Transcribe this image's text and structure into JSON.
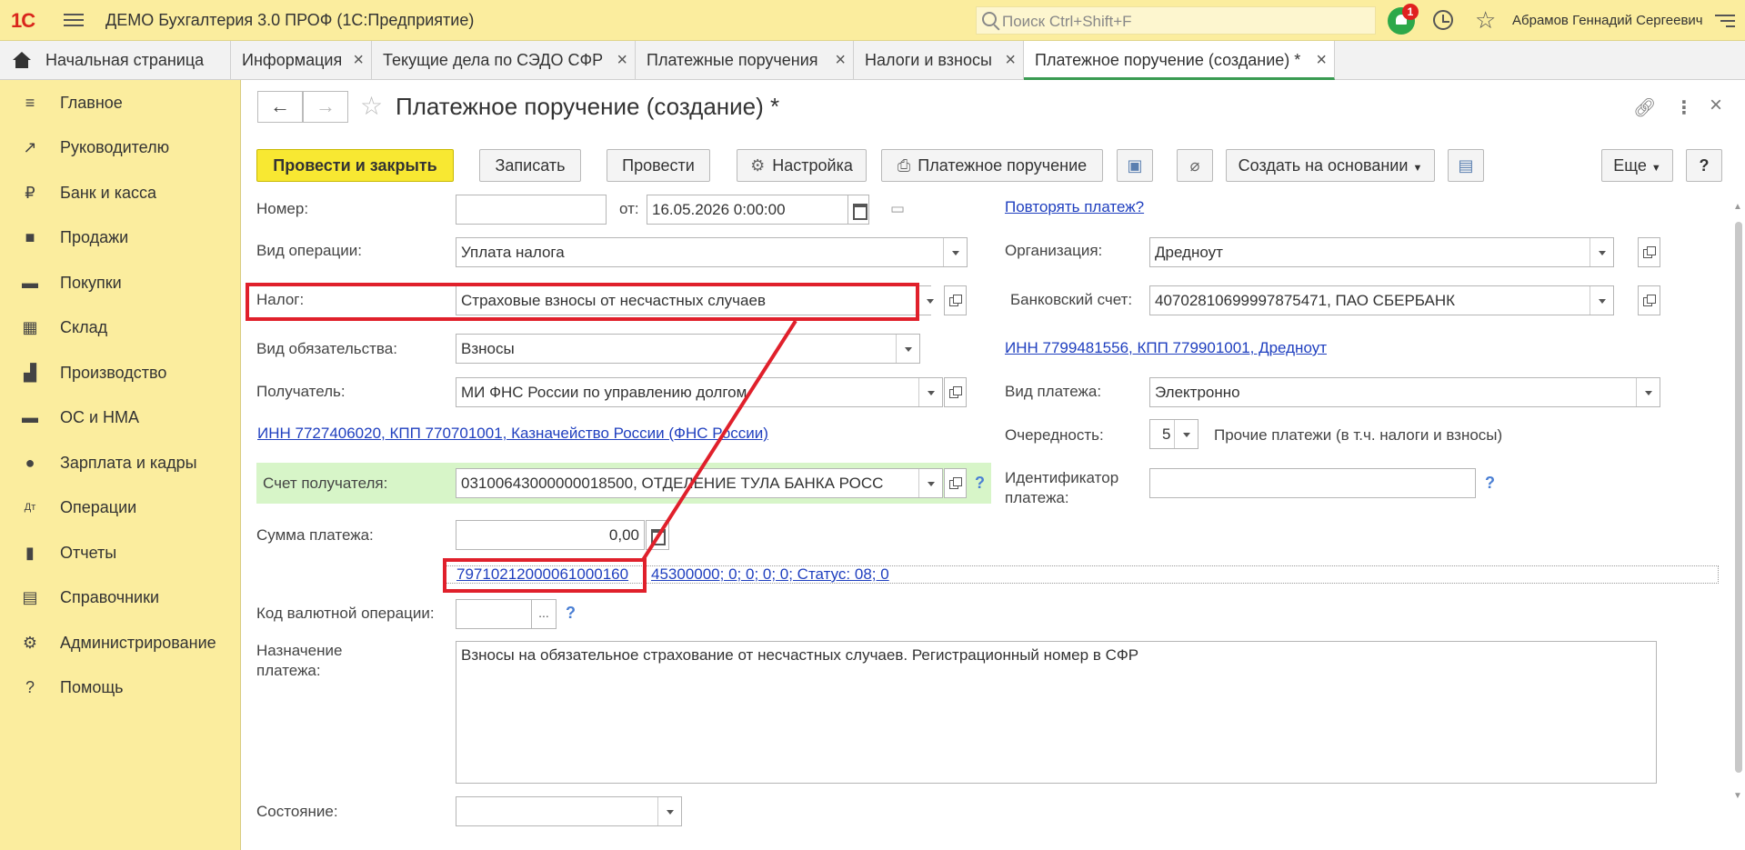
{
  "app": {
    "logo": "1С",
    "title": "ДЕМО Бухгалтерия 3.0 ПРОФ  (1С:Предприятие)",
    "search_placeholder": "Поиск Ctrl+Shift+F",
    "notifications_count": "1",
    "user": "Абрамов Геннадий Сергеевич"
  },
  "tabs": [
    {
      "label": "Начальная страница"
    },
    {
      "label": "Информация"
    },
    {
      "label": "Текущие дела по СЭДО СФР"
    },
    {
      "label": "Платежные поручения"
    },
    {
      "label": "Налоги и взносы"
    },
    {
      "label": "Платежное поручение (создание) *"
    }
  ],
  "sidebar": {
    "items": [
      {
        "label": "Главное",
        "icon": "menu-icon"
      },
      {
        "label": "Руководителю",
        "icon": "trend-icon"
      },
      {
        "label": "Банк и касса",
        "icon": "ruble-icon"
      },
      {
        "label": "Продажи",
        "icon": "bag-icon"
      },
      {
        "label": "Покупки",
        "icon": "cart-icon"
      },
      {
        "label": "Склад",
        "icon": "warehouse-icon"
      },
      {
        "label": "Производство",
        "icon": "factory-icon"
      },
      {
        "label": "ОС и НМА",
        "icon": "truck-icon"
      },
      {
        "label": "Зарплата и кадры",
        "icon": "person-icon"
      },
      {
        "label": "Операции",
        "icon": "dt-kt-icon"
      },
      {
        "label": "Отчеты",
        "icon": "bar-chart-icon"
      },
      {
        "label": "Справочники",
        "icon": "books-icon"
      },
      {
        "label": "Администрирование",
        "icon": "gear-icon"
      },
      {
        "label": "Помощь",
        "icon": "question-icon"
      }
    ]
  },
  "form": {
    "title": "Платежное поручение (создание) *",
    "toolbar": {
      "post_close": "Провести и закрыть",
      "save": "Записать",
      "post": "Провести",
      "settings": "Настройка",
      "print": "Платежное поручение",
      "create_based": "Создать на основании",
      "more": "Еще",
      "help": "?"
    },
    "number_label": "Номер:",
    "number_value": "",
    "date_label": "от:",
    "date_value": "16.05.2026  0:00:00",
    "repeat_link": "Повторять платеж?",
    "operation_label": "Вид операции:",
    "operation_value": "Уплата налога",
    "org_label": "Организация:",
    "org_value": "Дредноут",
    "tax_label": "Налог:",
    "tax_value": "Страховые взносы от несчастных случаев",
    "bank_label": "Банковский счет:",
    "bank_value": "40702810699997875471, ПАО СБЕРБАНК",
    "obligation_label": "Вид обязательства:",
    "obligation_value": "Взносы",
    "org_inn_link": "ИНН 7799481556, КПП 779901001, Дредноут",
    "recipient_label": "Получатель:",
    "recipient_value": "МИ ФНС России по управлению долгом",
    "payment_type_label": "Вид платежа:",
    "payment_type_value": "Электронно",
    "recipient_inn_link": "ИНН 7727406020, КПП 770701001, Казначейство России (ФНС России)",
    "priority_label": "Очередность:",
    "priority_value": "5",
    "priority_desc": "Прочие платежи (в т.ч. налоги и взносы)",
    "account_label": "Счет получателя:",
    "account_value": "03100643000000018500, ОТДЕЛЕНИЕ ТУЛА БАНКА РОСС",
    "identifier_label_1": "Идентификатор",
    "identifier_label_2": "платежа:",
    "identifier_value": "",
    "amount_label": "Сумма платежа:",
    "amount_value": "0,00",
    "kbk_link": "79710212000061000160",
    "kbk_rest": "45300000; 0; 0; 0; 0; Статус: 08; 0",
    "currency_label": "Код валютной операции:",
    "currency_value": "",
    "purpose_label_1": "Назначение",
    "purpose_label_2": "платежа:",
    "purpose_value": "Взносы на обязательное страхование от несчастных случаев. Регистрационный номер в СФР",
    "state_label": "Состояние:",
    "state_value": ""
  },
  "colors": {
    "accent_yellow": "#fbed9e",
    "primary_button": "#f8e832",
    "highlight_red": "#e0202b",
    "link_blue": "#1f3fbf",
    "green_row": "#d7f5c8",
    "active_tab": "#3a9b52"
  }
}
